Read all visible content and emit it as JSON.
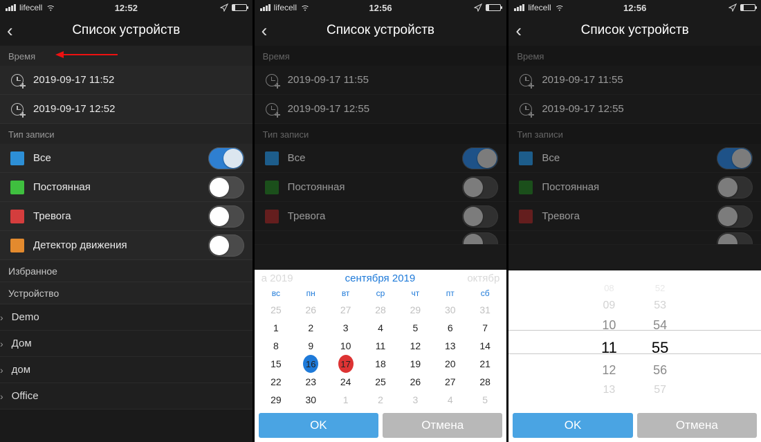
{
  "screens": {
    "a": {
      "status": {
        "carrier": "lifecell",
        "time": "12:52"
      },
      "title": "Список устройств",
      "sections": {
        "time_hdr": "Время",
        "type_hdr": "Тип записи",
        "fav_hdr": "Избранное",
        "dev_hdr": "Устройство"
      },
      "times": {
        "from": "2019-09-17 11:52",
        "to": "2019-09-17 12:52"
      },
      "types": [
        {
          "label": "Все",
          "color": "#2d8fd6",
          "on": true
        },
        {
          "label": "Постоянная",
          "color": "#3fbf3f",
          "on": false
        },
        {
          "label": "Тревога",
          "color": "#d43d3d",
          "on": false
        },
        {
          "label": "Детектор движения",
          "color": "#e38a2e",
          "on": false
        }
      ],
      "devices": [
        "Demo",
        "Дом",
        "дом",
        "Office"
      ]
    },
    "b": {
      "status": {
        "carrier": "lifecell",
        "time": "12:56"
      },
      "title": "Список устройств",
      "sections": {
        "time_hdr": "Время",
        "type_hdr": "Тип записи"
      },
      "times": {
        "from": "2019-09-17 11:55",
        "to": "2019-09-17 12:55"
      },
      "types": [
        {
          "label": "Все",
          "color": "#2d8fd6",
          "on": true
        },
        {
          "label": "Постоянная",
          "color": "#3fbf3f",
          "on": false
        },
        {
          "label": "Тревога",
          "color": "#d43d3d",
          "on": false
        }
      ],
      "calendar": {
        "prev": "а 2019",
        "cur": "сентября 2019",
        "next": "октябр",
        "dow": [
          "вс",
          "пн",
          "вт",
          "ср",
          "чт",
          "пт",
          "сб"
        ],
        "lead": [
          25,
          26,
          27,
          28,
          29,
          30,
          31
        ],
        "days": [
          1,
          2,
          3,
          4,
          5,
          6,
          7,
          8,
          9,
          10,
          11,
          12,
          13,
          14,
          15,
          16,
          17,
          18,
          19,
          20,
          21,
          22,
          23,
          24,
          25,
          26,
          27,
          28,
          29,
          30
        ],
        "tail": [
          1,
          2,
          3,
          4,
          5
        ],
        "selected": 16,
        "today": 17
      },
      "buttons": {
        "ok": "OK",
        "cancel": "Отмена"
      }
    },
    "c": {
      "status": {
        "carrier": "lifecell",
        "time": "12:56"
      },
      "title": "Список устройств",
      "sections": {
        "time_hdr": "Время",
        "type_hdr": "Тип записи"
      },
      "times": {
        "from": "2019-09-17 11:55",
        "to": "2019-09-17 12:55"
      },
      "types": [
        {
          "label": "Все",
          "color": "#2d8fd6",
          "on": true
        },
        {
          "label": "Постоянная",
          "color": "#3fbf3f",
          "on": false
        },
        {
          "label": "Тревога",
          "color": "#d43d3d",
          "on": false
        }
      ],
      "timepicker": {
        "hours": [
          "08",
          "09",
          "10",
          "11",
          "12",
          "13"
        ],
        "mins": [
          "52",
          "53",
          "54",
          "55",
          "56",
          "57"
        ],
        "sel_h": "11",
        "sel_m": "55"
      },
      "buttons": {
        "ok": "OK",
        "cancel": "Отмена"
      }
    }
  }
}
